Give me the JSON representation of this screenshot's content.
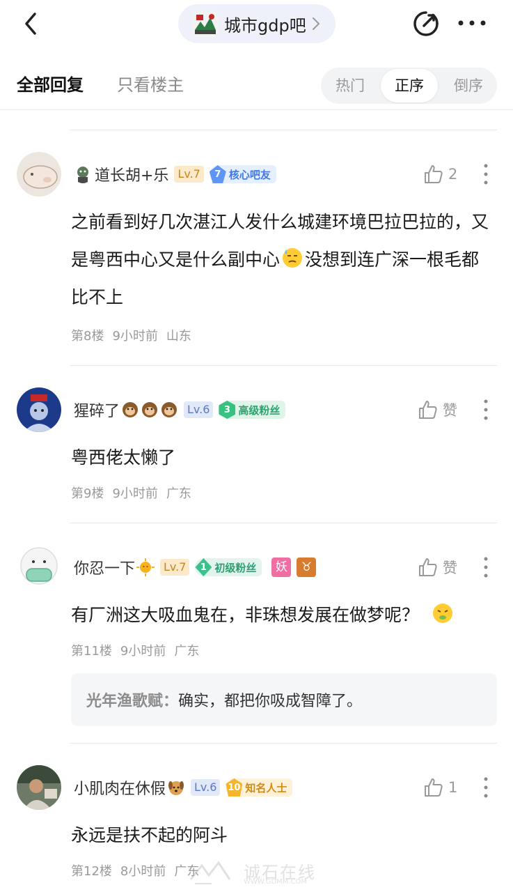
{
  "header": {
    "forum_name": "城市gdp吧",
    "icons": {
      "back": "back-arrow-icon",
      "share": "share-icon",
      "more": "more-icon",
      "forum": "forum-avatar",
      "chevron": "chevron-right-icon"
    }
  },
  "filters": {
    "tab_all": "全部回复",
    "tab_host": "只看楼主",
    "sort_options": [
      "热门",
      "正序",
      "倒序"
    ],
    "sort_selected": "正序"
  },
  "colors": {
    "lv7": "#c48622",
    "lv6": "#5878c8",
    "accent_blue": "#3f78e8",
    "meta_gray": "#9a9a9a"
  },
  "posts": [
    {
      "username": "道长胡+乐",
      "level": "Lv.7",
      "badge_num": "7",
      "badge_text": "核心吧友",
      "likes": "2",
      "content_1": "之前看到好几次湛江人发什么城建环境巴拉巴拉的，又是粤西中心又是什么副中心",
      "content_2": "没想到连广深一根毛都比不上",
      "floor": "第8楼",
      "time": "9小时前",
      "location": "山东"
    },
    {
      "username": "猩碎了",
      "level": "Lv.6",
      "badge_num": "3",
      "badge_text": "高级粉丝",
      "likes": "赞",
      "content": "粤西佬太懒了",
      "floor": "第9楼",
      "time": "9小时前",
      "location": "广东"
    },
    {
      "username": "你忍一下",
      "level": "Lv.7",
      "badge_num": "1",
      "badge_text": "初级粉丝",
      "tag_1": "妖",
      "tag_2": "♉",
      "likes": "赞",
      "content": "有厂洲这大吸血鬼在，非珠想发展在做梦呢？",
      "floor": "第11楼",
      "time": "9小时前",
      "location": "广东",
      "reply": {
        "author": "光年渔歌赋：",
        "text": "确实，都把你吸成智障了。"
      }
    },
    {
      "username": "小肌肉在休假",
      "level": "Lv.6",
      "badge_num": "10",
      "badge_text": "知名人士",
      "likes": "1",
      "content": "永远是扶不起的阿斗",
      "floor": "第12楼",
      "time": "8小时前",
      "location": "广东"
    }
  ],
  "watermark": {
    "text": "诚石在线",
    "sub": "WWW.GDMM.COM"
  }
}
